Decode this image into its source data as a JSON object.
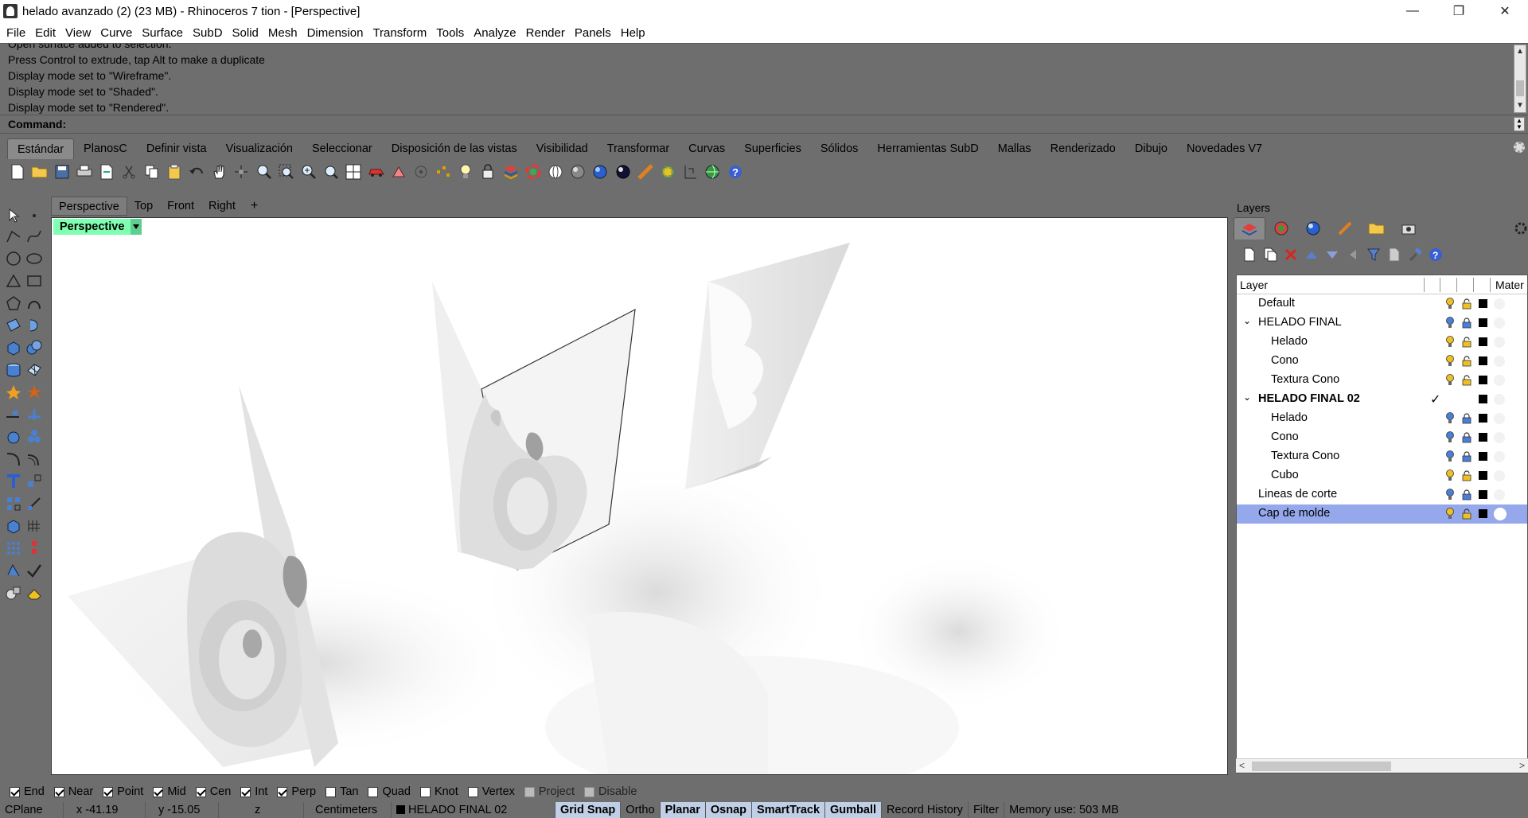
{
  "window": {
    "title": "helado avanzado (2) (23 MB) - Rhinoceros 7 tion - [Perspective]",
    "minimize": "—",
    "maximize": "❐",
    "close": "✕"
  },
  "menu": [
    "File",
    "Edit",
    "View",
    "Curve",
    "Surface",
    "SubD",
    "Solid",
    "Mesh",
    "Dimension",
    "Transform",
    "Tools",
    "Analyze",
    "Render",
    "Panels",
    "Help"
  ],
  "command_history": [
    "Open surface added to selection.",
    "Press Control to extrude, tap Alt to make a duplicate",
    "Display mode set to \"Wireframe\".",
    "Display mode set to \"Shaded\".",
    "Display mode set to \"Rendered\"."
  ],
  "command": {
    "label": "Command:",
    "value": ""
  },
  "toolbar_tabs": [
    "Estándar",
    "PlanosC",
    "Definir vista",
    "Visualización",
    "Seleccionar",
    "Disposición de las vistas",
    "Visibilidad",
    "Transformar",
    "Curvas",
    "Superficies",
    "Sólidos",
    "Herramientas SubD",
    "Mallas",
    "Renderizado",
    "Dibujo",
    "Novedades V7"
  ],
  "active_toolbar_tab": "Estándar",
  "view_tabs": [
    "Perspective",
    "Top",
    "Front",
    "Right"
  ],
  "view_tab_add": "+",
  "viewport": {
    "label": "Perspective"
  },
  "layers_panel": {
    "title": "Layers",
    "header_layer": "Layer",
    "header_material": "Mater",
    "layers": [
      {
        "name": "Default",
        "level": 0,
        "expander": "",
        "current": false,
        "selected": false,
        "bulb": "#f0c020",
        "lock": "#f0c020"
      },
      {
        "name": "HELADO FINAL",
        "level": 0,
        "expander": "⌄",
        "current": false,
        "selected": false,
        "bulb": "#4a7fd8",
        "lock": "#4a7fd8"
      },
      {
        "name": "Helado",
        "level": 1,
        "expander": "",
        "current": false,
        "selected": false,
        "bulb": "#f0c020",
        "lock": "#f0c020"
      },
      {
        "name": "Cono",
        "level": 1,
        "expander": "",
        "current": false,
        "selected": false,
        "bulb": "#f0c020",
        "lock": "#f0c020"
      },
      {
        "name": "Textura Cono",
        "level": 1,
        "expander": "",
        "current": false,
        "selected": false,
        "bulb": "#f0c020",
        "lock": "#f0c020"
      },
      {
        "name": "HELADO FINAL 02",
        "level": 0,
        "expander": "⌄",
        "current": true,
        "selected": false,
        "bulb": "",
        "lock": ""
      },
      {
        "name": "Helado",
        "level": 1,
        "expander": "",
        "current": false,
        "selected": false,
        "bulb": "#4a7fd8",
        "lock": "#4a7fd8"
      },
      {
        "name": "Cono",
        "level": 1,
        "expander": "",
        "current": false,
        "selected": false,
        "bulb": "#4a7fd8",
        "lock": "#4a7fd8"
      },
      {
        "name": "Textura Cono",
        "level": 1,
        "expander": "",
        "current": false,
        "selected": false,
        "bulb": "#4a7fd8",
        "lock": "#4a7fd8"
      },
      {
        "name": "Cubo",
        "level": 1,
        "expander": "",
        "current": false,
        "selected": false,
        "bulb": "#f0c020",
        "lock": "#f0c020"
      },
      {
        "name": "Lineas de corte",
        "level": 0,
        "expander": "",
        "current": false,
        "selected": false,
        "bulb": "#4a7fd8",
        "lock": "#4a7fd8"
      },
      {
        "name": "Cap de molde",
        "level": 0,
        "expander": "",
        "current": false,
        "selected": true,
        "bulb": "#f0c020",
        "lock": "#f0c020"
      }
    ],
    "current_mark": "✓"
  },
  "osnaps": [
    {
      "label": "End",
      "checked": true,
      "enabled": true
    },
    {
      "label": "Near",
      "checked": true,
      "enabled": true
    },
    {
      "label": "Point",
      "checked": true,
      "enabled": true
    },
    {
      "label": "Mid",
      "checked": true,
      "enabled": true
    },
    {
      "label": "Cen",
      "checked": true,
      "enabled": true
    },
    {
      "label": "Int",
      "checked": true,
      "enabled": true
    },
    {
      "label": "Perp",
      "checked": true,
      "enabled": true
    },
    {
      "label": "Tan",
      "checked": false,
      "enabled": true
    },
    {
      "label": "Quad",
      "checked": false,
      "enabled": true
    },
    {
      "label": "Knot",
      "checked": false,
      "enabled": true
    },
    {
      "label": "Vertex",
      "checked": false,
      "enabled": true
    },
    {
      "label": "Project",
      "checked": false,
      "enabled": false
    },
    {
      "label": "Disable",
      "checked": false,
      "enabled": false
    }
  ],
  "status": {
    "cplane": "CPlane",
    "x": "x -41.19",
    "y": "y -15.05",
    "z": "z",
    "units": "Centimeters",
    "layer": "HELADO FINAL 02",
    "toggles": [
      {
        "label": "Grid Snap",
        "on": true
      },
      {
        "label": "Ortho",
        "on": false
      },
      {
        "label": "Planar",
        "on": true
      },
      {
        "label": "Osnap",
        "on": true
      },
      {
        "label": "SmartTrack",
        "on": true
      },
      {
        "label": "Gumball",
        "on": true
      },
      {
        "label": "Record History",
        "on": false
      },
      {
        "label": "Filter",
        "on": false
      }
    ],
    "memory": "Memory use: 503 MB"
  },
  "colors": {
    "accent_selection": "#96a8ec",
    "viewport_label": "#7fffb0",
    "chrome": "#6e6e6e"
  }
}
